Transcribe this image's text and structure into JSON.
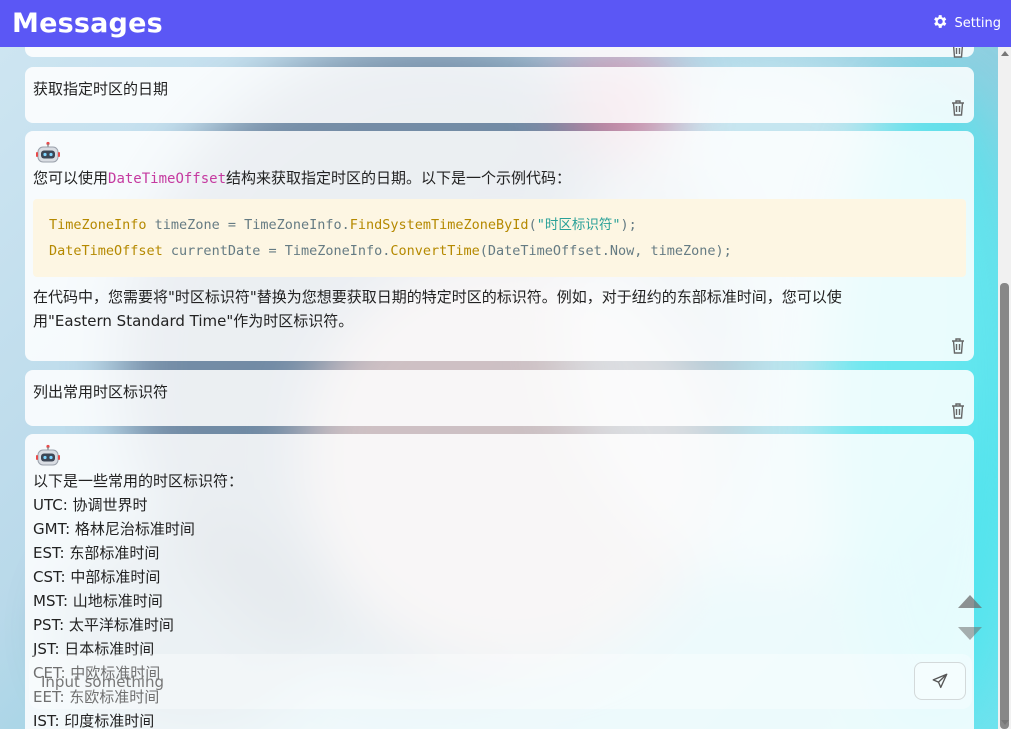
{
  "app": {
    "title": "Messages",
    "setting_label": "Setting"
  },
  "messages": [
    {
      "role": "user",
      "text": "获取指定时区的日期"
    },
    {
      "role": "bot",
      "intro_before": "您可以使用",
      "intro_code": "DateTimeOffset",
      "intro_after": "结构来获取指定时区的日期。以下是一个示例代码：",
      "code": {
        "line1": {
          "type": "TimeZoneInfo",
          "var": " timeZone = TimeZoneInfo.",
          "fn": "FindSystemTimeZoneById",
          "open": "(",
          "str": "\"时区标识符\"",
          "close": ");"
        },
        "line2": {
          "type": "DateTimeOffset",
          "var": " currentDate = TimeZoneInfo.",
          "fn": "ConvertTime",
          "rest": "(DateTimeOffset.Now, timeZone);"
        }
      },
      "outro_1": "在代码中，您需要将\"时区标识符\"替换为您想要获取日期的特定时区的标识符。例如，对于纽约的东部标准时间，您可以使",
      "outro_2": "用\"Eastern Standard Time\"作为时区标识符。"
    },
    {
      "role": "user",
      "text": "列出常用时区标识符"
    },
    {
      "role": "bot",
      "intro": "以下是一些常用的时区标识符：",
      "list": [
        "UTC: 协调世界时",
        "GMT: 格林尼治标准时间",
        "EST: 东部标准时间",
        "CST: 中部标准时间",
        "MST: 山地标准时间",
        "PST: 太平洋标准时间",
        "JST: 日本标准时间",
        "CET: 中欧标准时间",
        "EET: 东欧标准时间",
        "IST: 印度标准时间"
      ]
    }
  ],
  "input": {
    "placeholder": "Input something",
    "value": ""
  },
  "icons": {
    "setting": "gear-icon",
    "delete": "trash-icon",
    "bot": "robot-icon",
    "send": "send-icon"
  },
  "colors": {
    "header": "#5b57f5",
    "code_bg": "#fdf6e3",
    "inline_code": "#c53aa0",
    "keyword": "#b58900",
    "string": "#2aa198"
  }
}
